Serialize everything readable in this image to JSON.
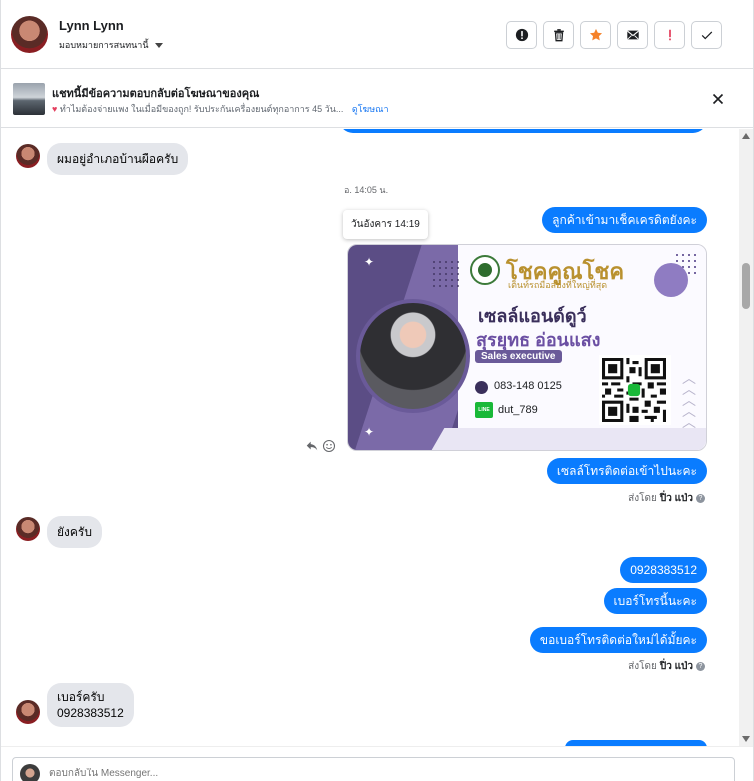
{
  "header": {
    "name": "Lynn Lynn",
    "subtitle": "มอบหมายการสนทนานี้",
    "actions": {
      "spam_icon": "exclamation-circle-icon",
      "delete_icon": "trash-icon",
      "star_icon": "star-icon",
      "email_icon": "envelope-icon",
      "alert_icon": "exclamation-icon",
      "done_icon": "check-icon"
    },
    "colors": {
      "star": "#f5822a",
      "alert": "#e4405f"
    }
  },
  "banner": {
    "title": "แชทนี้มีข้อความตอบกลับต่อโฆษณาของคุณ",
    "text": "ทำไมต้องจ่ายแพง ในเมื่อมีของถูก! รับประกันเครื่องยนต์ทุกอาการ 45 วัน...",
    "link": "ดูโฆษณา"
  },
  "messages": {
    "m1": "ผมอยู่อำเภอบ้านผือครับ",
    "time1": "อ. 14:05 น.",
    "tooltip": "วันอังคาร 14:19",
    "m2": "ลูกค้าเข้ามาเช็คเครดิตยังคะ",
    "m3": "เซลล์โทรติดต่อเข้าไปนะคะ",
    "sent_by_prefix": "ส่งโดย",
    "sent_by_name": "ปิ่ว แป่ว",
    "m4": "ยังครับ",
    "m5": "0928383512",
    "m6": "เบอร์โทรนี้นะคะ",
    "m7": "ขอเบอร์โทรติดต่อใหม่ได้มั้ยคะ",
    "m8_line1": "เบอร์ครับ",
    "m8_line2": "0928383512"
  },
  "card": {
    "brand": "โชคคูณโชค",
    "tagline": "เต็นท์รถมือสองที่ใหญ่ที่สุด",
    "name_line1": "เซลล์แอนด์ดูว์",
    "name_line2": "สุรยุทธ อ่อนแสง",
    "role": "Sales executive",
    "phone": "083-148 0125",
    "line_label": "LINE",
    "line_id": "dut_789"
  },
  "composer": {
    "placeholder": "ตอบกลับใน Messenger..."
  }
}
